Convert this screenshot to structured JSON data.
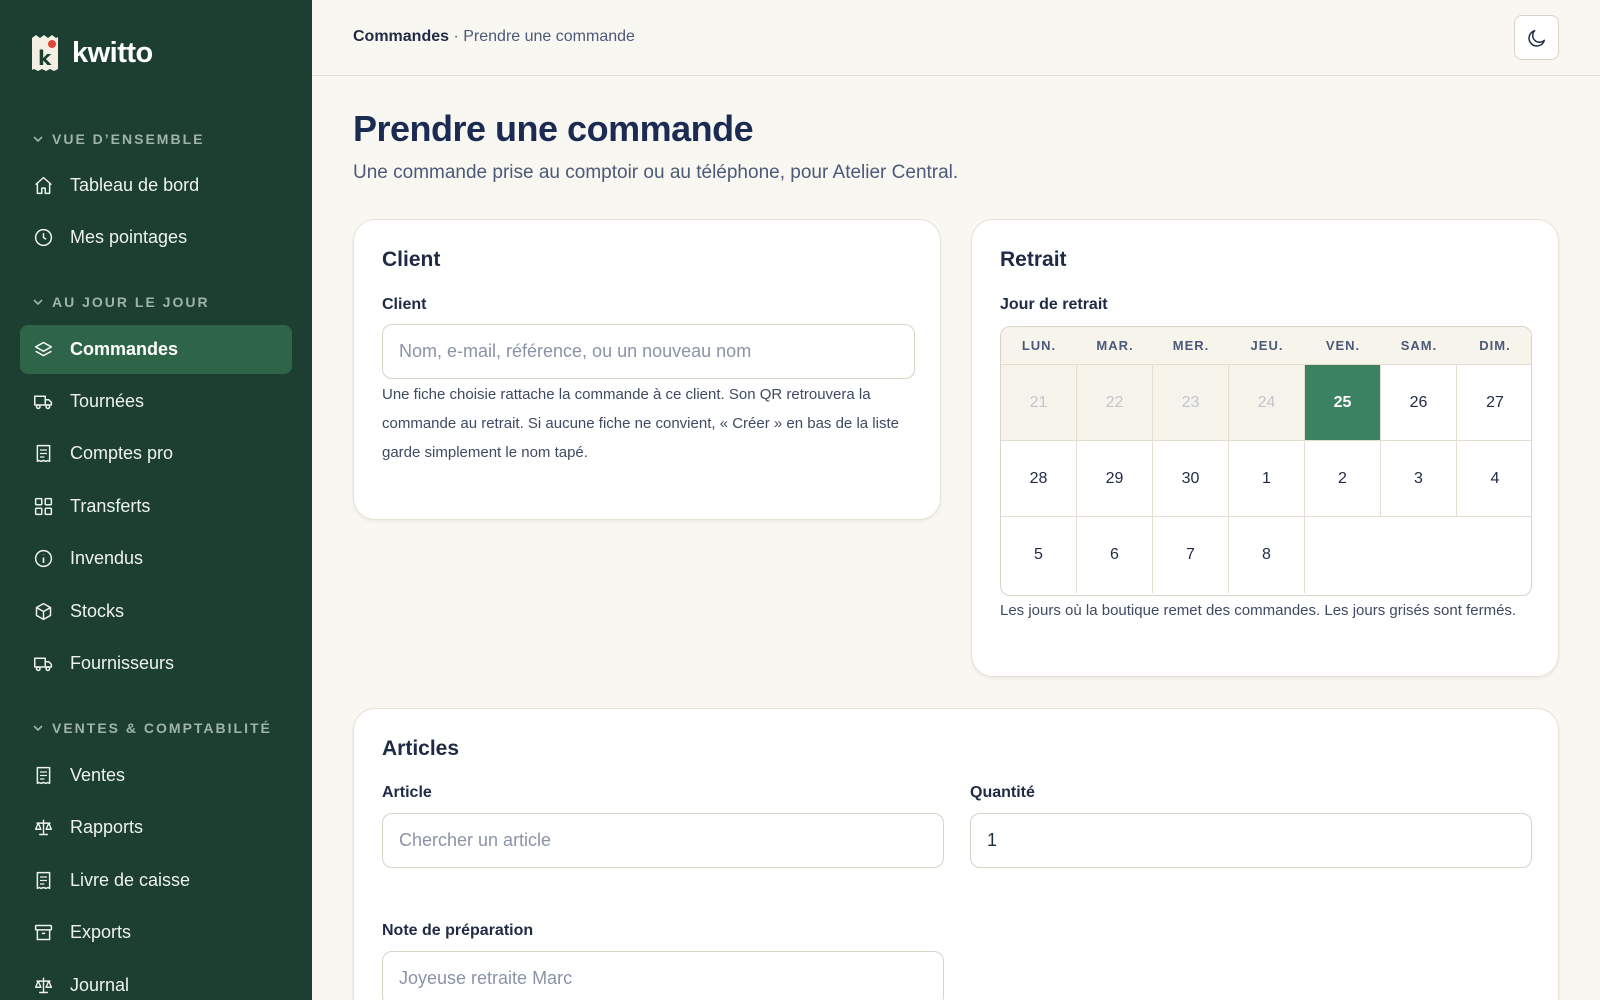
{
  "brand": {
    "name": "kwitto",
    "logo_letter": "k"
  },
  "sidebar": {
    "sections": [
      {
        "title": "VUE D’ENSEMBLE",
        "items": [
          {
            "label": "Tableau de bord",
            "icon": "home-icon"
          },
          {
            "label": "Mes pointages",
            "icon": "clock-icon"
          }
        ]
      },
      {
        "title": "AU JOUR LE JOUR",
        "items": [
          {
            "label": "Commandes",
            "icon": "layers-icon",
            "active": true
          },
          {
            "label": "Tournées",
            "icon": "truck-icon"
          },
          {
            "label": "Comptes pro",
            "icon": "receipt-icon"
          },
          {
            "label": "Transferts",
            "icon": "grid-icon"
          },
          {
            "label": "Invendus",
            "icon": "info-icon"
          },
          {
            "label": "Stocks",
            "icon": "box-icon"
          },
          {
            "label": "Fournisseurs",
            "icon": "truck-icon"
          }
        ]
      },
      {
        "title": "VENTES & COMPTABILITÉ",
        "items": [
          {
            "label": "Ventes",
            "icon": "receipt-icon"
          },
          {
            "label": "Rapports",
            "icon": "scale-icon"
          },
          {
            "label": "Livre de caisse",
            "icon": "receipt-icon"
          },
          {
            "label": "Exports",
            "icon": "archive-icon"
          },
          {
            "label": "Journal",
            "icon": "scale-icon"
          }
        ]
      }
    ]
  },
  "breadcrumb": {
    "root": "Commandes",
    "separator": " · ",
    "current": "Prendre une commande"
  },
  "theme_toggle": {
    "icon": "moon-icon"
  },
  "page": {
    "title": "Prendre une commande",
    "subtitle": "Une commande prise au comptoir ou au téléphone, pour Atelier Central."
  },
  "client_card": {
    "title": "Client",
    "field_label": "Client",
    "placeholder": "Nom, e-mail, référence, ou un nouveau nom",
    "help_lines": [
      "Une fiche choisie rattache la commande à ce client. Son QR retrouvera la",
      "commande au retrait. Si aucune fiche ne convient, « Créer » en bas de la liste",
      "garde simplement le nom tapé."
    ]
  },
  "pickup_card": {
    "title": "Retrait",
    "field_label": "Jour de retrait",
    "weekdays": [
      "LUN.",
      "MAR.",
      "MER.",
      "JEU.",
      "VEN.",
      "SAM.",
      "DIM."
    ],
    "days": [
      {
        "label": "21",
        "state": "past"
      },
      {
        "label": "22",
        "state": "past"
      },
      {
        "label": "23",
        "state": "past"
      },
      {
        "label": "24",
        "state": "past"
      },
      {
        "label": "25",
        "state": "selected"
      },
      {
        "label": "26",
        "state": "open"
      },
      {
        "label": "27",
        "state": "open"
      },
      {
        "label": "28",
        "state": "open"
      },
      {
        "label": "29",
        "state": "open"
      },
      {
        "label": "30",
        "state": "open"
      },
      {
        "label": "1",
        "state": "open"
      },
      {
        "label": "2",
        "state": "open"
      },
      {
        "label": "3",
        "state": "open"
      },
      {
        "label": "4",
        "state": "open"
      },
      {
        "label": "5",
        "state": "open"
      },
      {
        "label": "6",
        "state": "open"
      },
      {
        "label": "7",
        "state": "open"
      },
      {
        "label": "8",
        "state": "open"
      }
    ],
    "help": "Les jours où la boutique remet des commandes. Les jours grisés sont fermés."
  },
  "articles_card": {
    "title": "Articles",
    "article_label": "Article",
    "article_placeholder": "Chercher un article",
    "quantity_label": "Quantité",
    "quantity_value": "1",
    "note_label": "Note de préparation",
    "note_placeholder": "Joyeuse retraite Marc"
  },
  "colors": {
    "sidebar_bg": "#1c3f31",
    "active_item_bg": "#2e6447",
    "selected_day": "#3a8260",
    "page_bg": "#f9f7f1",
    "logo_dot": "#e0453a"
  }
}
